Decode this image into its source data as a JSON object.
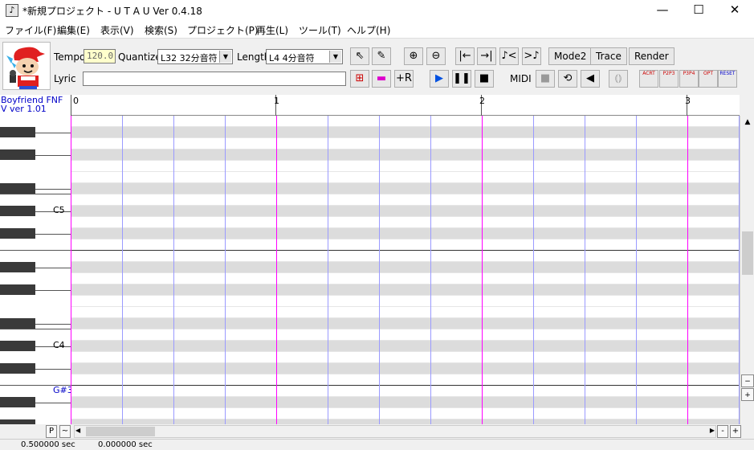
{
  "window": {
    "title": "*新規プロジェクト - U T A U Ver 0.4.18",
    "icon": "music-note-icon",
    "minimize": "—",
    "maximize": "☐",
    "close": "✕"
  },
  "menu": [
    "ファイル(F)",
    "編集(E)",
    "表示(V)",
    "検索(S)",
    "プロジェクト(P)",
    "再生(L)",
    "ツール(T)",
    "ヘルプ(H)"
  ],
  "toolbar": {
    "tempo_label": "Tempo",
    "tempo_value": "120.0",
    "quantize_label": "Quantize",
    "quantize_value": "L32 32分音符",
    "length_label": "Length",
    "length_value": "L4  4分音符",
    "lyric_label": "Lyric",
    "lyric_value": "",
    "mode2": "Mode2",
    "trace": "Trace",
    "render": "Render",
    "midi": "MIDI",
    "effects": [
      "ACRT",
      "P2P3",
      "P3P4",
      "OPT",
      "RESET"
    ]
  },
  "singer": {
    "name": "Boyfriend FNF",
    "version": "V ver 1.01"
  },
  "ruler": {
    "measures": [
      "0",
      "1",
      "2",
      "3"
    ]
  },
  "keyboard": {
    "labels": [
      "C5",
      "C4",
      "G#3"
    ]
  },
  "bottom": {
    "p_button": "P",
    "tilde_button": "~",
    "minus": "-",
    "plus": "+"
  },
  "status": {
    "time1": "0.500000 sec",
    "time2": "0.000000 sec"
  },
  "colors": {
    "accent": "#ff00ff",
    "beat_line": "#9a9aff",
    "key_label": "#0000c8",
    "grey_row": "#dcdcdc"
  }
}
